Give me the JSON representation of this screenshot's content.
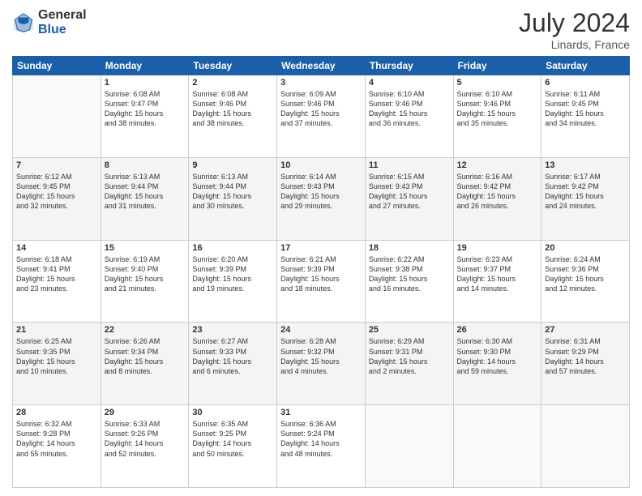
{
  "header": {
    "logo_general": "General",
    "logo_blue": "Blue",
    "month_year": "July 2024",
    "location": "Linards, France"
  },
  "weekdays": [
    "Sunday",
    "Monday",
    "Tuesday",
    "Wednesday",
    "Thursday",
    "Friday",
    "Saturday"
  ],
  "weeks": [
    [
      {
        "day": "",
        "info": ""
      },
      {
        "day": "1",
        "info": "Sunrise: 6:08 AM\nSunset: 9:47 PM\nDaylight: 15 hours\nand 38 minutes."
      },
      {
        "day": "2",
        "info": "Sunrise: 6:08 AM\nSunset: 9:46 PM\nDaylight: 15 hours\nand 38 minutes."
      },
      {
        "day": "3",
        "info": "Sunrise: 6:09 AM\nSunset: 9:46 PM\nDaylight: 15 hours\nand 37 minutes."
      },
      {
        "day": "4",
        "info": "Sunrise: 6:10 AM\nSunset: 9:46 PM\nDaylight: 15 hours\nand 36 minutes."
      },
      {
        "day": "5",
        "info": "Sunrise: 6:10 AM\nSunset: 9:46 PM\nDaylight: 15 hours\nand 35 minutes."
      },
      {
        "day": "6",
        "info": "Sunrise: 6:11 AM\nSunset: 9:45 PM\nDaylight: 15 hours\nand 34 minutes."
      }
    ],
    [
      {
        "day": "7",
        "info": "Sunrise: 6:12 AM\nSunset: 9:45 PM\nDaylight: 15 hours\nand 32 minutes."
      },
      {
        "day": "8",
        "info": "Sunrise: 6:13 AM\nSunset: 9:44 PM\nDaylight: 15 hours\nand 31 minutes."
      },
      {
        "day": "9",
        "info": "Sunrise: 6:13 AM\nSunset: 9:44 PM\nDaylight: 15 hours\nand 30 minutes."
      },
      {
        "day": "10",
        "info": "Sunrise: 6:14 AM\nSunset: 9:43 PM\nDaylight: 15 hours\nand 29 minutes."
      },
      {
        "day": "11",
        "info": "Sunrise: 6:15 AM\nSunset: 9:43 PM\nDaylight: 15 hours\nand 27 minutes."
      },
      {
        "day": "12",
        "info": "Sunrise: 6:16 AM\nSunset: 9:42 PM\nDaylight: 15 hours\nand 26 minutes."
      },
      {
        "day": "13",
        "info": "Sunrise: 6:17 AM\nSunset: 9:42 PM\nDaylight: 15 hours\nand 24 minutes."
      }
    ],
    [
      {
        "day": "14",
        "info": "Sunrise: 6:18 AM\nSunset: 9:41 PM\nDaylight: 15 hours\nand 23 minutes."
      },
      {
        "day": "15",
        "info": "Sunrise: 6:19 AM\nSunset: 9:40 PM\nDaylight: 15 hours\nand 21 minutes."
      },
      {
        "day": "16",
        "info": "Sunrise: 6:20 AM\nSunset: 9:39 PM\nDaylight: 15 hours\nand 19 minutes."
      },
      {
        "day": "17",
        "info": "Sunrise: 6:21 AM\nSunset: 9:39 PM\nDaylight: 15 hours\nand 18 minutes."
      },
      {
        "day": "18",
        "info": "Sunrise: 6:22 AM\nSunset: 9:38 PM\nDaylight: 15 hours\nand 16 minutes."
      },
      {
        "day": "19",
        "info": "Sunrise: 6:23 AM\nSunset: 9:37 PM\nDaylight: 15 hours\nand 14 minutes."
      },
      {
        "day": "20",
        "info": "Sunrise: 6:24 AM\nSunset: 9:36 PM\nDaylight: 15 hours\nand 12 minutes."
      }
    ],
    [
      {
        "day": "21",
        "info": "Sunrise: 6:25 AM\nSunset: 9:35 PM\nDaylight: 15 hours\nand 10 minutes."
      },
      {
        "day": "22",
        "info": "Sunrise: 6:26 AM\nSunset: 9:34 PM\nDaylight: 15 hours\nand 8 minutes."
      },
      {
        "day": "23",
        "info": "Sunrise: 6:27 AM\nSunset: 9:33 PM\nDaylight: 15 hours\nand 6 minutes."
      },
      {
        "day": "24",
        "info": "Sunrise: 6:28 AM\nSunset: 9:32 PM\nDaylight: 15 hours\nand 4 minutes."
      },
      {
        "day": "25",
        "info": "Sunrise: 6:29 AM\nSunset: 9:31 PM\nDaylight: 15 hours\nand 2 minutes."
      },
      {
        "day": "26",
        "info": "Sunrise: 6:30 AM\nSunset: 9:30 PM\nDaylight: 14 hours\nand 59 minutes."
      },
      {
        "day": "27",
        "info": "Sunrise: 6:31 AM\nSunset: 9:29 PM\nDaylight: 14 hours\nand 57 minutes."
      }
    ],
    [
      {
        "day": "28",
        "info": "Sunrise: 6:32 AM\nSunset: 9:28 PM\nDaylight: 14 hours\nand 55 minutes."
      },
      {
        "day": "29",
        "info": "Sunrise: 6:33 AM\nSunset: 9:26 PM\nDaylight: 14 hours\nand 52 minutes."
      },
      {
        "day": "30",
        "info": "Sunrise: 6:35 AM\nSunset: 9:25 PM\nDaylight: 14 hours\nand 50 minutes."
      },
      {
        "day": "31",
        "info": "Sunrise: 6:36 AM\nSunset: 9:24 PM\nDaylight: 14 hours\nand 48 minutes."
      },
      {
        "day": "",
        "info": ""
      },
      {
        "day": "",
        "info": ""
      },
      {
        "day": "",
        "info": ""
      }
    ]
  ]
}
